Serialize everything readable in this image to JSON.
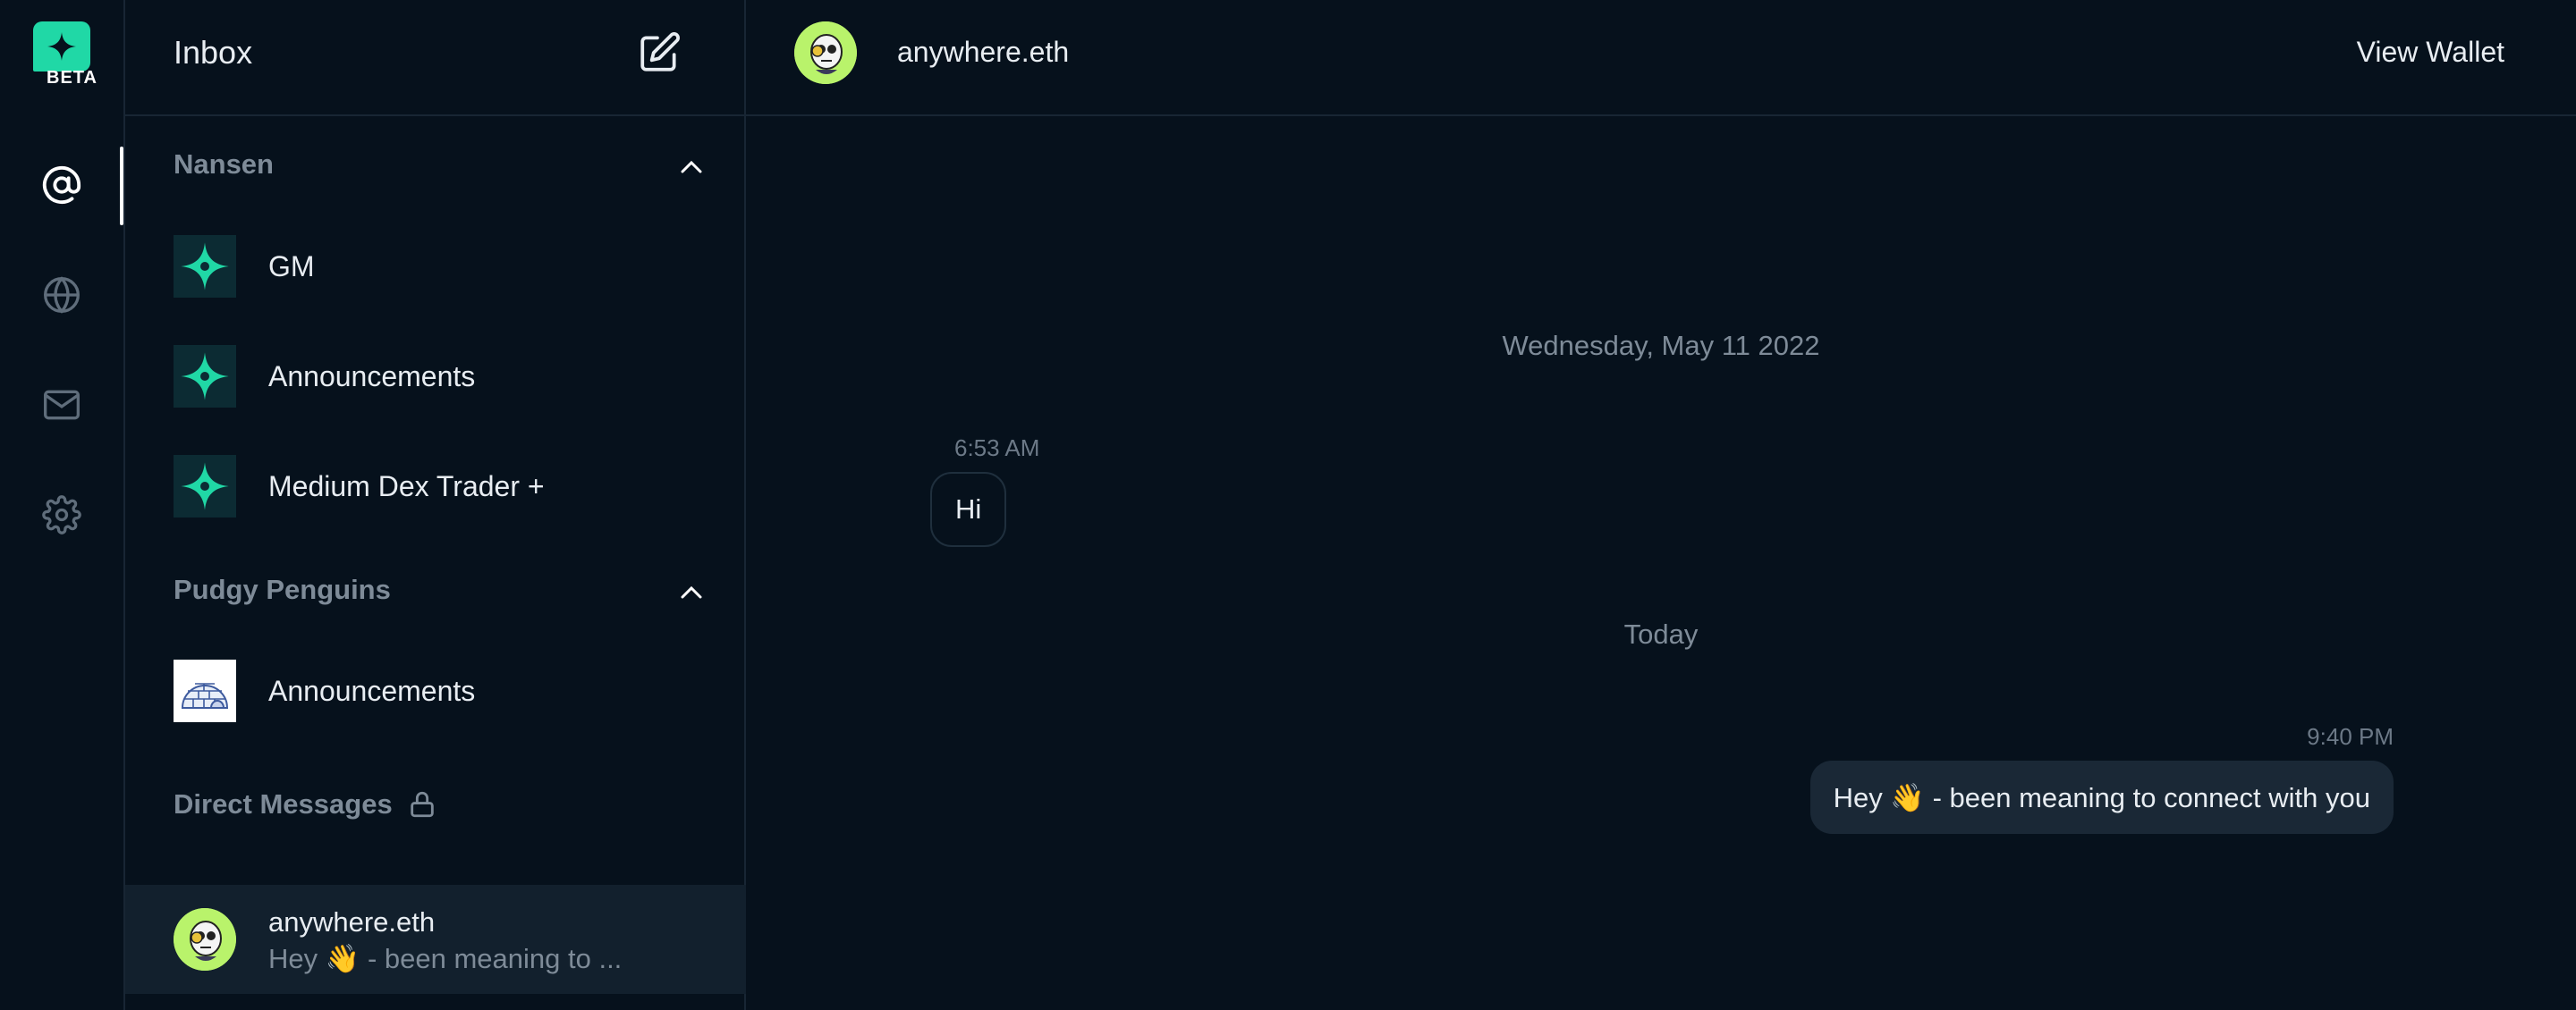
{
  "app": {
    "beta_label": "BETA"
  },
  "rail": {
    "items": [
      {
        "icon": "at-icon",
        "active": true
      },
      {
        "icon": "globe-icon",
        "active": false
      },
      {
        "icon": "mail-icon",
        "active": false
      },
      {
        "icon": "gear-icon",
        "active": false
      }
    ]
  },
  "sidebar": {
    "title": "Inbox",
    "compose_icon": "compose-icon",
    "sections": [
      {
        "title": "Nansen",
        "expanded": true,
        "channels": [
          "GM",
          "Announcements",
          "Medium Dex Trader +"
        ]
      },
      {
        "title": "Pudgy Penguins",
        "expanded": true,
        "channels": [
          "Announcements"
        ]
      }
    ],
    "direct_messages": {
      "title": "Direct Messages",
      "icon": "lock-icon",
      "items": [
        {
          "name": "anywhere.eth",
          "preview": "Hey 👋 - been meaning to ..."
        }
      ]
    }
  },
  "conversation": {
    "name": "anywhere.eth",
    "view_wallet": "View Wallet",
    "groups": [
      {
        "date": "Wednesday, May 11 2022",
        "messages": [
          {
            "time": "6:53 AM",
            "text": "Hi",
            "direction": "incoming"
          }
        ]
      },
      {
        "date": "Today",
        "messages": [
          {
            "time": "9:40 PM",
            "text": "Hey 👋 - been meaning to connect with you",
            "direction": "outgoing"
          }
        ]
      }
    ]
  },
  "colors": {
    "background": "#06111c",
    "accent": "#20d8a6",
    "selected_row": "#12202d",
    "outgoing_bubble": "#1a2836",
    "avatar": "#b9f36b"
  }
}
